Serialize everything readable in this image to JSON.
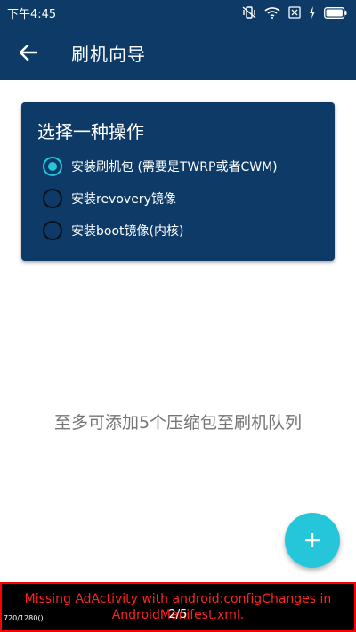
{
  "status_bar": {
    "time": "下午4:45",
    "icons": [
      "vibrate-icon",
      "wifi-icon",
      "sim-card-icon",
      "charging-icon",
      "battery-icon"
    ]
  },
  "app_bar": {
    "title": "刷机向导",
    "back_icon": "arrow-back-icon"
  },
  "card": {
    "title": "选择一种操作",
    "options": [
      {
        "label": "安装刷机包 (需要是TWRP或者CWM)",
        "checked": true
      },
      {
        "label": "安装revovery镜像",
        "checked": false
      },
      {
        "label": "安装boot镜像(内核)",
        "checked": false
      }
    ]
  },
  "empty_hint": "至多可添加5个压缩包至刷机队列",
  "fab": {
    "icon": "plus-icon"
  },
  "ad_banner": {
    "message": "Missing AdActivity with android:configChanges in AndroidManifest.xml.",
    "dimensions": "720/1280()",
    "page": "2/5"
  },
  "colors": {
    "primary": "#0d3a66",
    "accent": "#26c6da",
    "error": "#ff0000"
  }
}
